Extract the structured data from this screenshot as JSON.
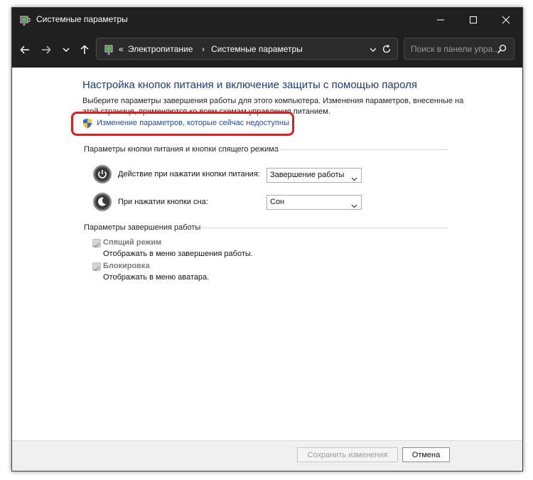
{
  "window": {
    "title": "Системные параметры"
  },
  "nav": {
    "breadcrumb_overflow": "«",
    "breadcrumb_1": "Электропитание",
    "breadcrumb_sep": "›",
    "breadcrumb_2": "Системные параметры",
    "search_placeholder": "Поиск в панели упра..."
  },
  "main": {
    "heading": "Настройка кнопок питания и включение защиты с помощью пароля",
    "description": "Выберите параметры завершения работы для этого компьютера. Изменения параметров, внесенные на этой странице, применяются ко всем схемам управления питанием.",
    "admin_link": "Изменение параметров, которые сейчас недоступны",
    "power_section": {
      "title": "Параметры кнопки питания и кнопки спящего режима",
      "power_button_label": "Действие при нажатии кнопки питания:",
      "power_button_value": "Завершение работы",
      "sleep_button_label": "При нажатии кнопки сна:",
      "sleep_button_value": "Сон"
    },
    "shutdown_section": {
      "title": "Параметры завершения работы",
      "sleep_label": "Спящий режим",
      "sleep_desc": "Отображать в меню завершения работы.",
      "sleep_checked": true,
      "lock_label": "Блокировка",
      "lock_desc": "Отображать в меню аватара.",
      "lock_checked": true
    }
  },
  "footer": {
    "save_label": "Сохранить изменения",
    "cancel_label": "Отмена"
  },
  "colors": {
    "titlebar": "#202020",
    "heading": "#1e3c78",
    "link": "#1a4e9f",
    "highlight": "#e02020"
  }
}
